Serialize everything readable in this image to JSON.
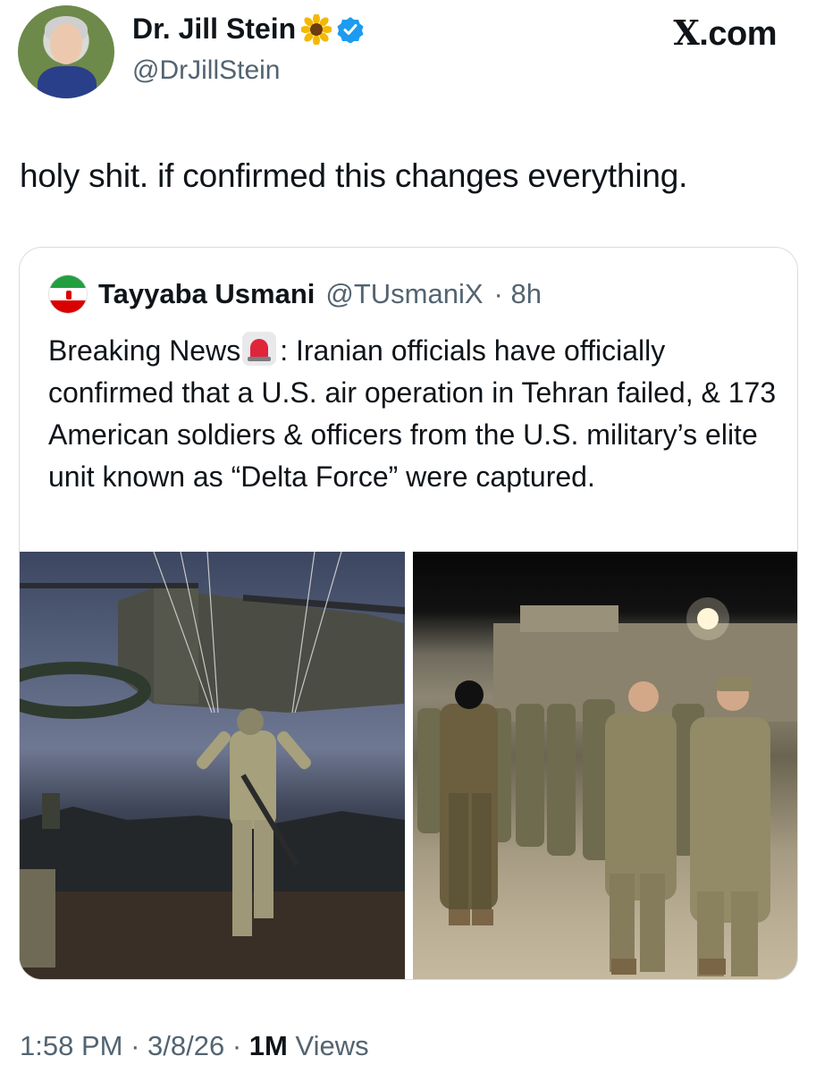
{
  "author": {
    "display_name": "Dr. Jill Stein",
    "handle": "@DrJillStein",
    "emoji_icon": "sunflower-icon",
    "verified_icon": "verified-badge-icon",
    "verified_color": "#1d9bf0"
  },
  "site": {
    "label": "X.com"
  },
  "tweet": {
    "text": "holy shit. if confirmed this changes everything."
  },
  "quote": {
    "author_name": "Tayyaba Usmani",
    "author_handle": "@TUsmaniX",
    "time": "· 8h",
    "flag_icon": "iran-flag-icon",
    "text_before": "Breaking News",
    "emoji_icon": "siren-icon",
    "text_after": ": Iranian officials have officially confirmed that a U.S. air operation in Tehran failed, & 173 American soldiers & officers from the U.S. military’s elite unit known as “Delta Force” were captured."
  },
  "meta": {
    "time": "1:58 PM",
    "date": "· 3/8/26 ·",
    "views_count": "1M",
    "views_label": "Views"
  },
  "colors": {
    "text": "#0f1419",
    "secondary": "#536471",
    "border": "#d6dde2"
  }
}
